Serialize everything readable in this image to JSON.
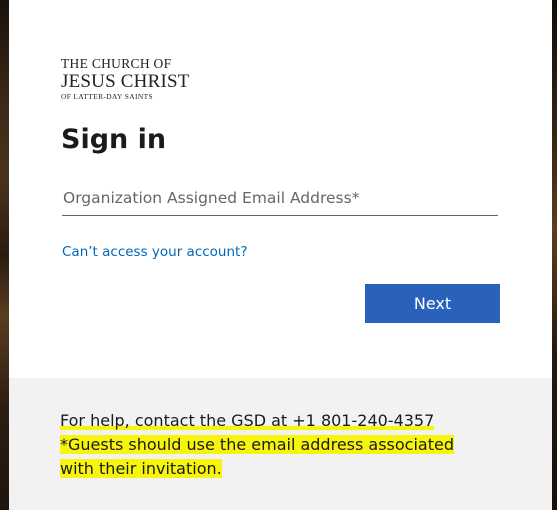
{
  "logo": {
    "line1": "THE CHURCH OF",
    "line2": "JESUS CHRIST",
    "line3": "OF LATTER-DAY SAINTS"
  },
  "signin": {
    "title": "Sign in",
    "email_placeholder": "Organization Assigned Email Address*",
    "email_value": "",
    "cant_access_link": "Can’t access your account?",
    "next_button": "Next"
  },
  "footer": {
    "help_text": "For help, contact the GSD at +1 801-240-4357",
    "guest_line1": "*Guests should use the email address associated",
    "guest_line2": "with their invitation."
  },
  "colors": {
    "primary_button": "#2a61ba",
    "link": "#0067b8",
    "highlight": "#f7f50c",
    "footer_bg": "#f2f2f2"
  }
}
